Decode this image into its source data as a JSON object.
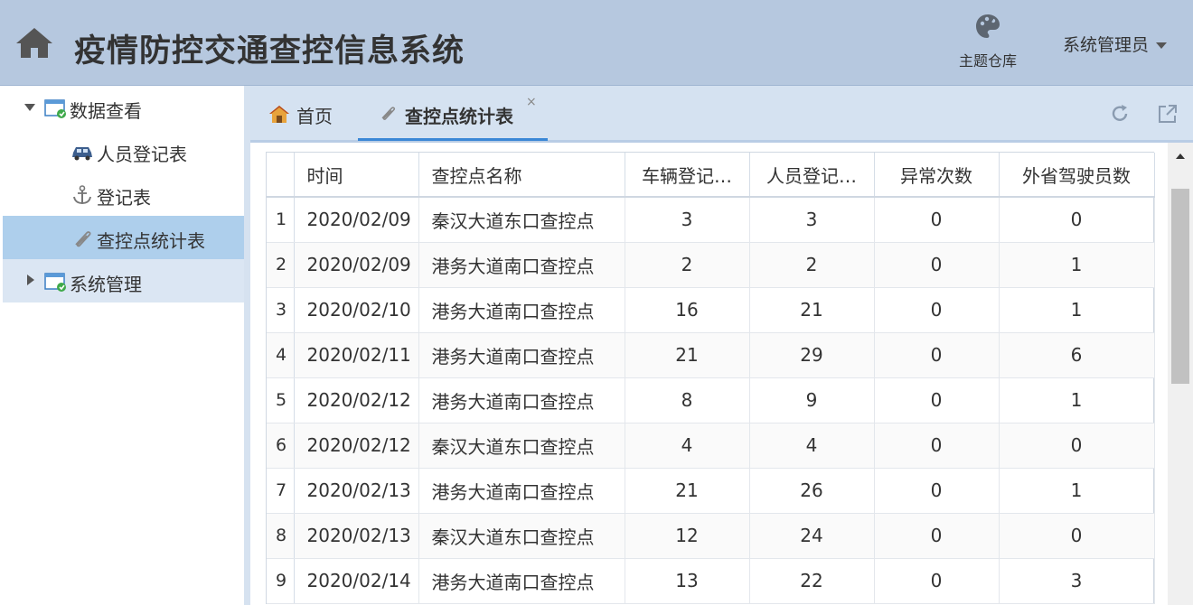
{
  "header": {
    "title": "疫情防控交通查控信息系统",
    "home_icon": "home-icon",
    "theme_label": "主题仓库",
    "user_label": "系统管理员"
  },
  "sidebar": {
    "groups": [
      {
        "label": "数据查看",
        "expanded": true,
        "icon": "folder-window-icon",
        "items": [
          {
            "label": "人员登记表",
            "icon": "car-icon"
          },
          {
            "label": "登记表",
            "icon": "anchor-icon"
          },
          {
            "label": "查控点统计表",
            "icon": "paperclip-icon",
            "selected": true
          }
        ]
      },
      {
        "label": "系统管理",
        "expanded": false,
        "icon": "folder-window-icon",
        "items": []
      }
    ]
  },
  "tabs": [
    {
      "label": "首页",
      "icon": "home-icon"
    },
    {
      "label": "查控点统计表",
      "icon": "paperclip-icon",
      "active": true,
      "close": "×"
    }
  ],
  "table": {
    "columns": [
      "",
      "时间",
      "查控点名称",
      "车辆登记…",
      "人员登记…",
      "异常次数",
      "外省驾驶员数"
    ],
    "rows": [
      [
        "1",
        "2020/02/09",
        "秦汉大道东口查控点",
        "3",
        "3",
        "0",
        "0"
      ],
      [
        "2",
        "2020/02/09",
        "港务大道南口查控点",
        "2",
        "2",
        "0",
        "1"
      ],
      [
        "3",
        "2020/02/10",
        "港务大道南口查控点",
        "16",
        "21",
        "0",
        "1"
      ],
      [
        "4",
        "2020/02/11",
        "港务大道南口查控点",
        "21",
        "29",
        "0",
        "6"
      ],
      [
        "5",
        "2020/02/12",
        "港务大道南口查控点",
        "8",
        "9",
        "0",
        "1"
      ],
      [
        "6",
        "2020/02/12",
        "秦汉大道东口查控点",
        "4",
        "4",
        "0",
        "0"
      ],
      [
        "7",
        "2020/02/13",
        "港务大道南口查控点",
        "21",
        "26",
        "0",
        "1"
      ],
      [
        "8",
        "2020/02/13",
        "秦汉大道东口查控点",
        "12",
        "24",
        "0",
        "0"
      ],
      [
        "9",
        "2020/02/14",
        "港务大道南口查控点",
        "13",
        "22",
        "0",
        "3"
      ]
    ]
  },
  "colors": {
    "header_bg": "#b6c8df",
    "selected_bg": "#aecfec",
    "tab_accent": "#3a87d6"
  }
}
